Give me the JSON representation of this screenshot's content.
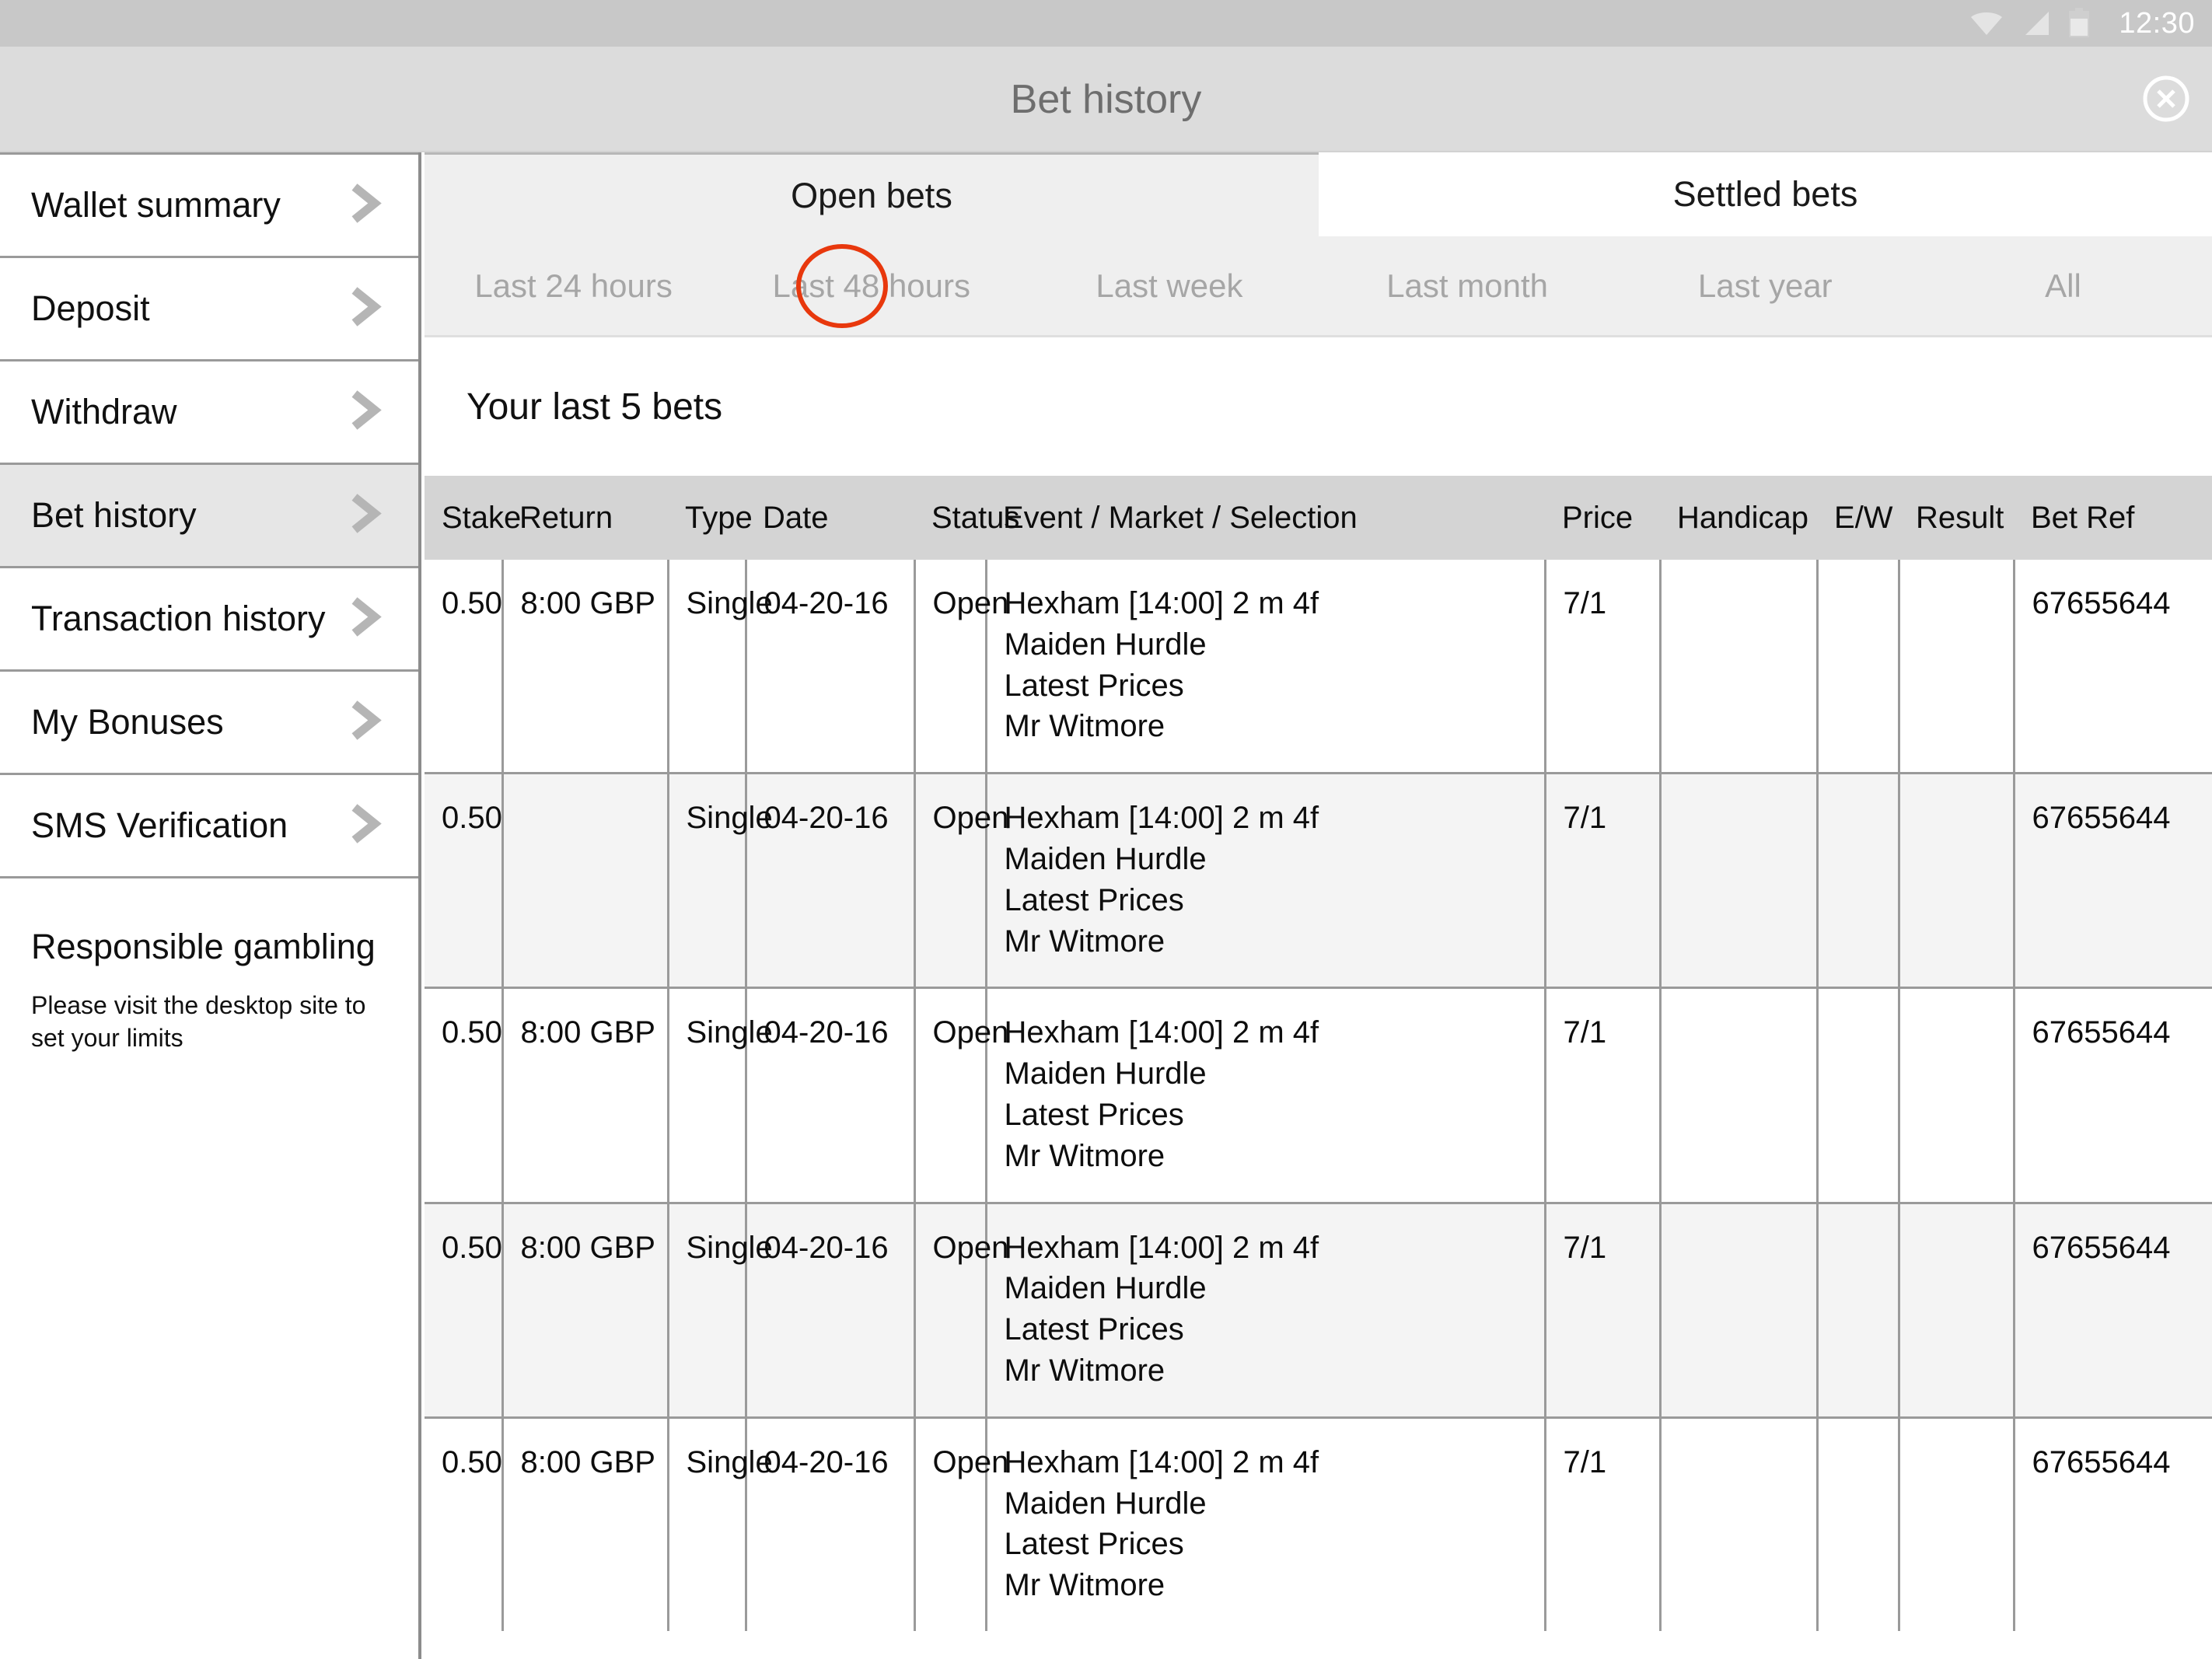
{
  "statusbar": {
    "clock": "12:30",
    "icons": [
      "wifi-icon",
      "signal-icon",
      "battery-icon"
    ]
  },
  "titlebar": {
    "title": "Bet history",
    "close_icon": "close-circle-icon"
  },
  "sidebar": {
    "items": [
      {
        "label": "Wallet summary",
        "active": false,
        "chevron": "chevron-right-icon"
      },
      {
        "label": "Deposit",
        "active": false,
        "chevron": "chevron-right-icon"
      },
      {
        "label": "Withdraw",
        "active": false,
        "chevron": "chevron-right-icon"
      },
      {
        "label": "Bet history",
        "active": true,
        "chevron": "chevron-right-icon"
      },
      {
        "label": "Transaction history",
        "active": false,
        "chevron": "chevron-right-icon"
      },
      {
        "label": "My Bonuses",
        "active": false,
        "chevron": "chevron-right-icon"
      },
      {
        "label": "SMS Verification",
        "active": false,
        "chevron": "chevron-right-icon"
      }
    ],
    "responsible": {
      "title": "Responsible gambling",
      "text": "Please visit the desktop site to set your limits"
    }
  },
  "main": {
    "tabs": [
      {
        "label": "Open bets",
        "selected": false
      },
      {
        "label": "Settled bets",
        "selected": true
      }
    ],
    "filters": [
      "Last 24 hours",
      "Last 48 hours",
      "Last week",
      "Last month",
      "Last year",
      "All"
    ],
    "highlight": {
      "target": "Last 48 hours",
      "color": "#e8380d"
    },
    "section_title": "Your last 5 bets",
    "table": {
      "columns": [
        "Stake",
        "Return",
        "Type",
        "Date",
        "Status",
        "Event / Market / Selection",
        "Price",
        "Handicap",
        "E/W",
        "Result",
        "Bet Ref"
      ],
      "rows": [
        {
          "stake": "0.50",
          "return": "8:00 GBP",
          "type": "Single",
          "date": "04-20-16",
          "status": "Open",
          "event": [
            "Hexham [14:00] 2 m 4f",
            "Maiden Hurdle",
            "Latest Prices",
            "Mr Witmore"
          ],
          "price": "7/1",
          "handicap": "",
          "ew": "",
          "result": "",
          "bet_ref": "67655644"
        },
        {
          "stake": "0.50",
          "return": "",
          "type": "Single",
          "date": "04-20-16",
          "status": "Open",
          "event": [
            "Hexham [14:00] 2 m 4f",
            "Maiden Hurdle",
            "Latest Prices",
            "Mr Witmore"
          ],
          "price": "7/1",
          "handicap": "",
          "ew": "",
          "result": "",
          "bet_ref": "67655644"
        },
        {
          "stake": "0.50",
          "return": "8:00 GBP",
          "type": "Single",
          "date": "04-20-16",
          "status": "Open",
          "event": [
            "Hexham [14:00] 2 m 4f",
            "Maiden Hurdle",
            "Latest Prices",
            "Mr Witmore"
          ],
          "price": "7/1",
          "handicap": "",
          "ew": "",
          "result": "",
          "bet_ref": "67655644"
        },
        {
          "stake": "0.50",
          "return": "8:00 GBP",
          "type": "Single",
          "date": "04-20-16",
          "status": "Open",
          "event": [
            "Hexham [14:00] 2 m 4f",
            "Maiden Hurdle",
            "Latest Prices",
            "Mr Witmore"
          ],
          "price": "7/1",
          "handicap": "",
          "ew": "",
          "result": "",
          "bet_ref": "67655644"
        },
        {
          "stake": "0.50",
          "return": "8:00 GBP",
          "type": "Single",
          "date": "04-20-16",
          "status": "Open",
          "event": [
            "Hexham [14:00] 2 m 4f",
            "Maiden Hurdle",
            "Latest Prices",
            "Mr Witmore"
          ],
          "price": "7/1",
          "handicap": "",
          "ew": "",
          "result": "",
          "bet_ref": "67655644"
        }
      ]
    }
  }
}
